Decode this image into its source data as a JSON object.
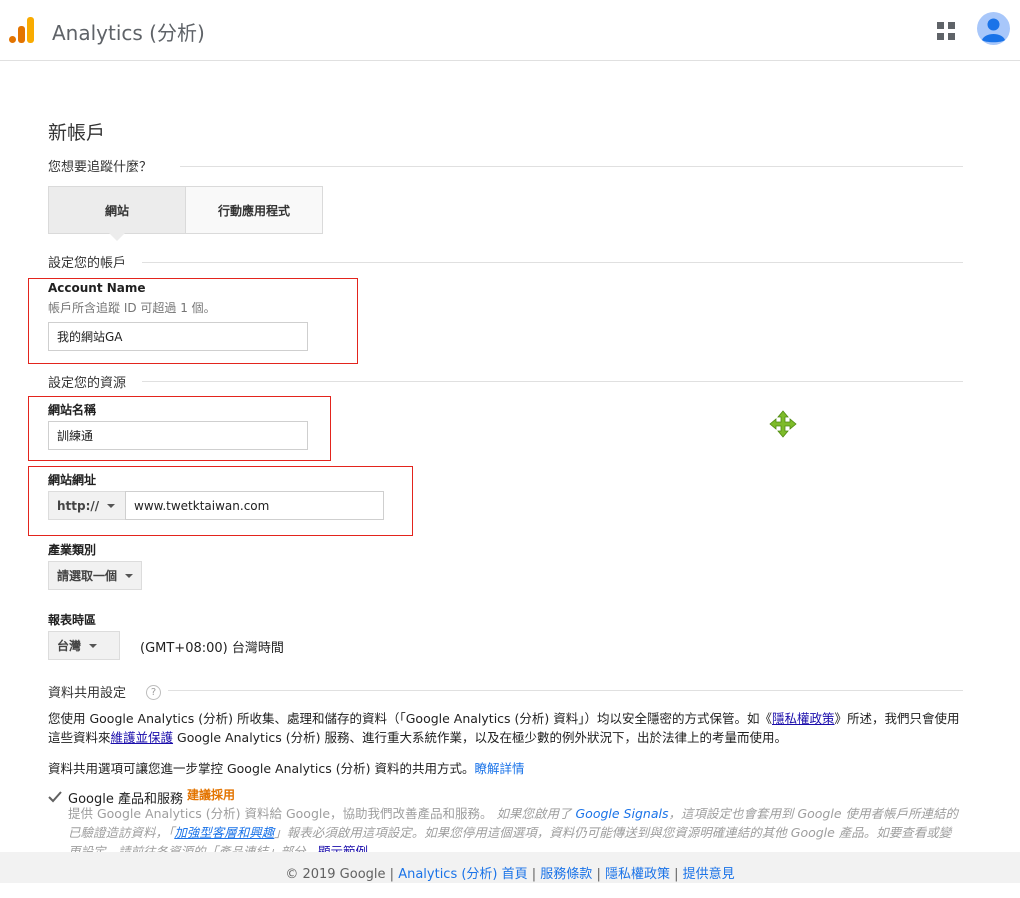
{
  "header": {
    "brand": "Analytics (分析)"
  },
  "page": {
    "title": "新帳戶",
    "track_question": "您想要追蹤什麼？",
    "tabs": [
      {
        "label": "網站",
        "active": true
      },
      {
        "label": "行動應用程式",
        "active": false
      }
    ]
  },
  "account": {
    "section": "設定您的帳戶",
    "label": "Account Name",
    "hint": "帳戶所含追蹤 ID 可超過 1 個。",
    "value": "我的網站GA"
  },
  "property": {
    "section": "設定您的資源",
    "site_name_label": "網站名稱",
    "site_name_value": "訓練通",
    "site_url_label": "網站網址",
    "protocol": "http://",
    "site_url_value": "www.twetktaiwan.com",
    "industry_label": "產業類別",
    "industry_value": "請選取一個",
    "timezone_label": "報表時區",
    "timezone_country": "台灣",
    "timezone_text": "(GMT+08:00) 台灣時間"
  },
  "sharing": {
    "section": "資料共用設定",
    "help": "?",
    "para1_a": "您使用 Google Analytics (分析) 所收集、處理和儲存的資料（「Google Analytics (分析) 資料」）均以安全隱密的方式保管。如《",
    "para1_link1": "隱私權政策",
    "para1_b": "》所述，我們只會使用這些資料來",
    "para1_link2": "維護並保護",
    "para1_c": " Google Analytics (分析) 服務、進行重大系統作業，以及在極少數的例外狀況下，出於法律上的考量而使用。",
    "para2": "資料共用選項可讓您進一步掌控 Google Analytics (分析) 資料的共用方式。",
    "para2_link": "瞭解詳情",
    "checkbox_label": "Google 產品和服務",
    "recommend": "建議採用",
    "desc_a": "提供 Google Analytics (分析) 資料給 Google，協助我們改善產品和服務。",
    "desc_b": " 如果您啟用了 ",
    "desc_signals": "Google Signals",
    "desc_c": "，這項設定也會套用到 Google 使用者帳戶所連結的已驗證造訪資料，「",
    "desc_demo": "加強型客層和興趣",
    "desc_d": "」報表必須啟用這項設定。如果您停用這個選項，資料仍可能傳送到與您資源明確連結的其他 Google 產品。如要查看或變更設定，請前往各資源的「產品連結」部分。",
    "desc_example": "顯示範例"
  },
  "footer": {
    "copyright": "© 2019 Google",
    "sep": " | ",
    "links": [
      "Analytics (分析) 首頁",
      "服務條款",
      "隱私權政策",
      "提供意見"
    ]
  },
  "colors": {
    "highlight_border": "#e3241d",
    "link": "#1a73e8",
    "recommend": "#e37400",
    "move_icon": "#7dbb2a"
  }
}
